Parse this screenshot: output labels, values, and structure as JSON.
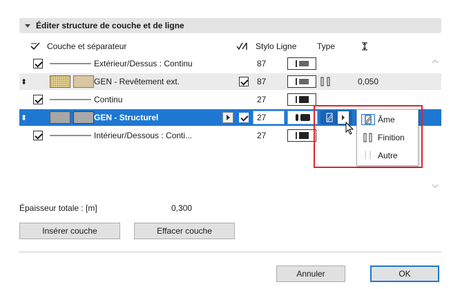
{
  "panel": {
    "title": "Éditer structure de couche et de ligne"
  },
  "columns": {
    "layer": "Couche et séparateur",
    "stylo_ligne": "Stylo Ligne",
    "type": "Type"
  },
  "rows": [
    {
      "kind": "line",
      "label": "Extérieur/Dessus : Continu",
      "stylo": "87",
      "checked": true
    },
    {
      "kind": "layer",
      "label": "GEN - Revêtement ext.",
      "stylo": "87",
      "thickness": "0,050",
      "checked": true
    },
    {
      "kind": "line",
      "label": "Continu",
      "stylo": "27",
      "checked": true
    },
    {
      "kind": "layer",
      "label": "GEN - Structurel",
      "stylo": "27",
      "checked": true,
      "selected": true
    },
    {
      "kind": "line",
      "label": "Intérieur/Dessous : Conti...",
      "stylo": "27",
      "checked": true
    }
  ],
  "type_menu": {
    "items": [
      {
        "label": "Âme",
        "icon": "core-hatch-icon"
      },
      {
        "label": "Finition",
        "icon": "finish-icon"
      },
      {
        "label": "Autre",
        "icon": "other-icon"
      }
    ]
  },
  "footer": {
    "total_label": "Épaisseur totale : [m]",
    "total_value": "0,300",
    "insert_button": "Insérer couche",
    "delete_button": "Effacer couche",
    "cancel_button": "Annuler",
    "ok_button": "OK"
  },
  "colors": {
    "selection": "#1e78d2",
    "highlight_frame": "#e0242b"
  }
}
